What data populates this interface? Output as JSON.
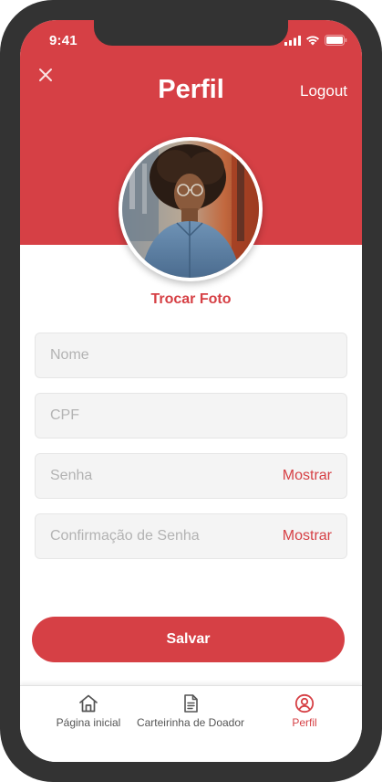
{
  "status_bar": {
    "time": "9:41"
  },
  "header": {
    "title": "Perfil",
    "logout_label": "Logout"
  },
  "profile": {
    "change_photo_label": "Trocar Foto"
  },
  "form": {
    "name": {
      "placeholder": "Nome",
      "value": ""
    },
    "cpf": {
      "placeholder": "CPF",
      "value": ""
    },
    "password": {
      "placeholder": "Senha",
      "value": "",
      "show_label": "Mostrar"
    },
    "confirm_password": {
      "placeholder": "Confirmação de Senha",
      "value": "",
      "show_label": "Mostrar"
    },
    "save_label": "Salvar"
  },
  "tabbar": {
    "items": [
      {
        "label": "Página inicial",
        "icon": "home-icon",
        "active": false
      },
      {
        "label": "Carteirinha de Doador",
        "icon": "document-icon",
        "active": false
      },
      {
        "label": "Perfil",
        "icon": "user-circle-icon",
        "active": true
      }
    ]
  },
  "colors": {
    "accent": "#d64045",
    "frame": "#333333",
    "field_bg": "#f4f4f4"
  }
}
